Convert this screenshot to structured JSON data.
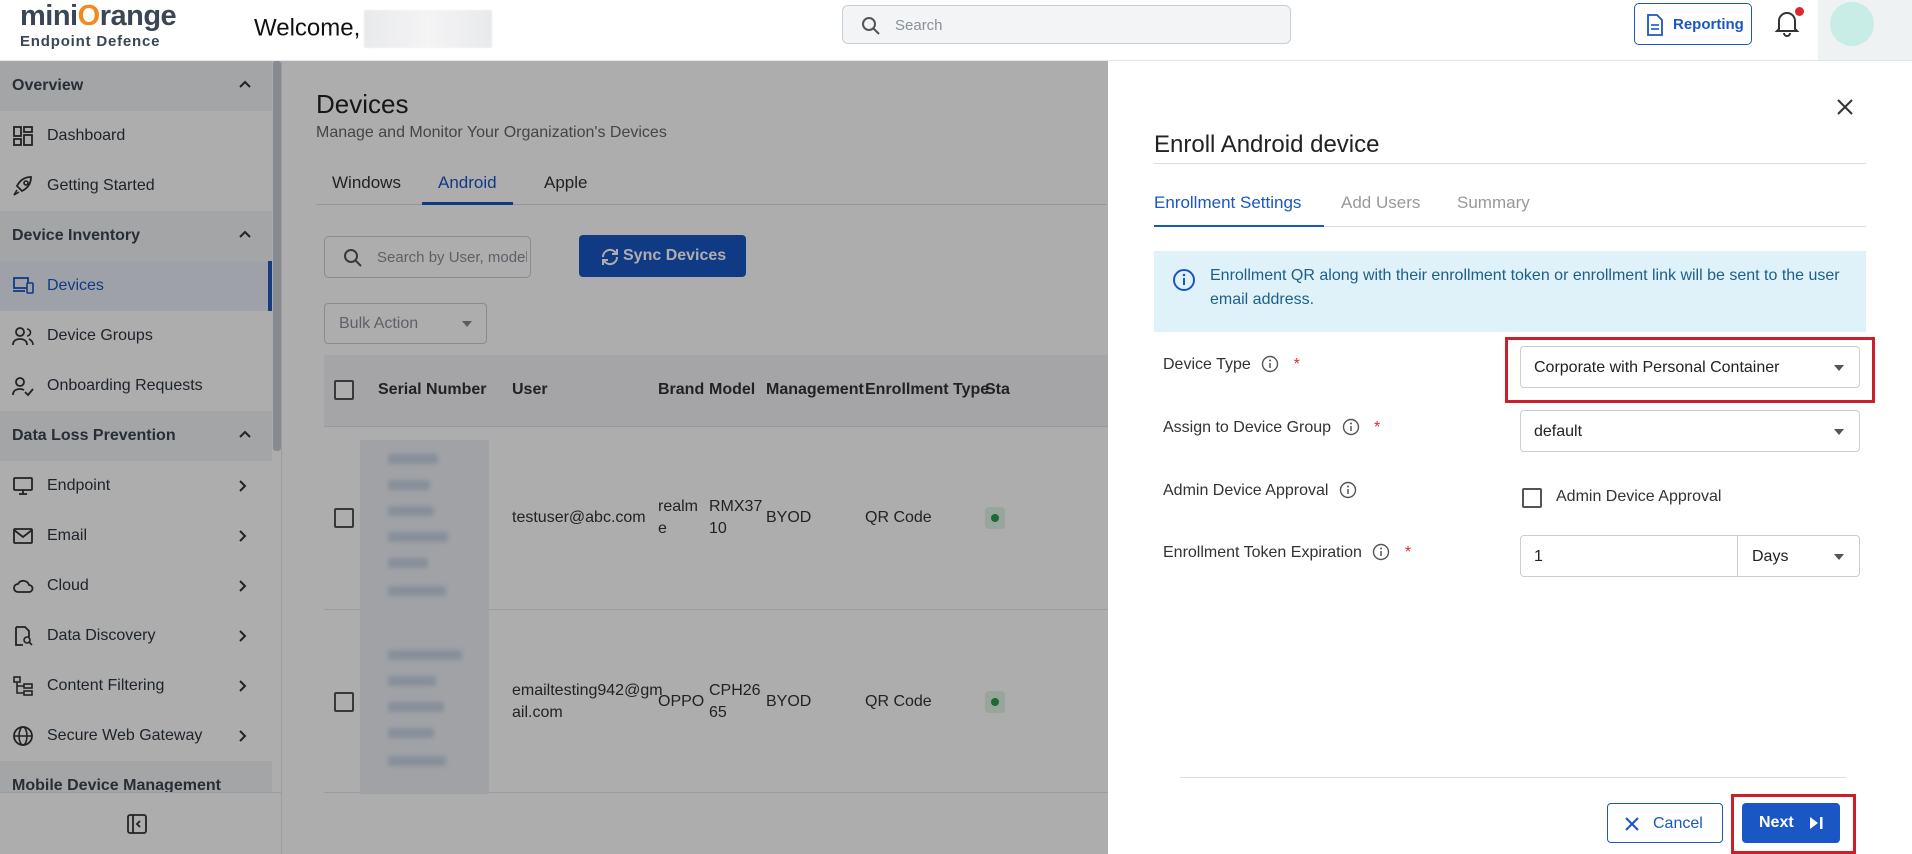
{
  "header": {
    "logo_main_a": "mini",
    "logo_main_o": "O",
    "logo_main_b": "range",
    "logo_sub": "Endpoint Defence",
    "welcome": "Welcome,",
    "search_placeholder": "Search",
    "reporting_label": "Reporting"
  },
  "sidebar": {
    "sections": {
      "overview": "Overview",
      "device_inventory": "Device Inventory",
      "dlp": "Data Loss Prevention",
      "mdm": "Mobile Device Management"
    },
    "items": {
      "dashboard": "Dashboard",
      "getting_started": "Getting Started",
      "devices": "Devices",
      "device_groups": "Device Groups",
      "onboarding": "Onboarding Requests",
      "endpoint": "Endpoint",
      "email": "Email",
      "cloud": "Cloud",
      "data_discovery": "Data Discovery",
      "content_filtering": "Content Filtering",
      "swg": "Secure Web Gateway"
    }
  },
  "main": {
    "title": "Devices",
    "subtitle": "Manage and Monitor Your Organization's Devices",
    "tabs": [
      "Windows",
      "Android",
      "Apple"
    ],
    "active_tab": "Android",
    "search_placeholder": "Search by User, model and serial",
    "sync_label": "Sync Devices",
    "bulk_label": "Bulk Action",
    "columns": [
      "Serial Number",
      "User",
      "Brand",
      "Model",
      "Management",
      "Enrollment Type",
      "Sta"
    ],
    "rows": [
      {
        "user": "testuser@abc.com",
        "brand_a": "realm",
        "brand_b": "e",
        "model_a": "RMX37",
        "model_b": "10",
        "management": "BYOD",
        "enrollment": "QR Code"
      },
      {
        "user_a": "emailtesting942@gm",
        "user_b": "ail.com",
        "brand": "OPPO",
        "model_a": "CPH26",
        "model_b": "65",
        "management": "BYOD",
        "enrollment": "QR Code"
      }
    ]
  },
  "drawer": {
    "title": "Enroll Android device",
    "tabs": [
      "Enrollment Settings",
      "Add Users",
      "Summary"
    ],
    "info": "Enrollment QR along with their enrollment token or enrollment link will be sent to the user email address.",
    "fields": {
      "device_type_label": "Device Type",
      "device_type_value": "Corporate with Personal Container",
      "group_label": "Assign to Device Group",
      "group_value": "default",
      "approval_label": "Admin Device Approval",
      "approval_checkbox": "Admin Device Approval",
      "expiration_label": "Enrollment Token Expiration",
      "expiration_value": "1",
      "expiration_unit": "Days"
    },
    "required_mark": "*",
    "cancel_label": "Cancel",
    "next_label": "Next"
  },
  "colors": {
    "accent": "#1a56c4",
    "highlight": "#cc1f2a",
    "info_bg": "#dff2f9"
  }
}
